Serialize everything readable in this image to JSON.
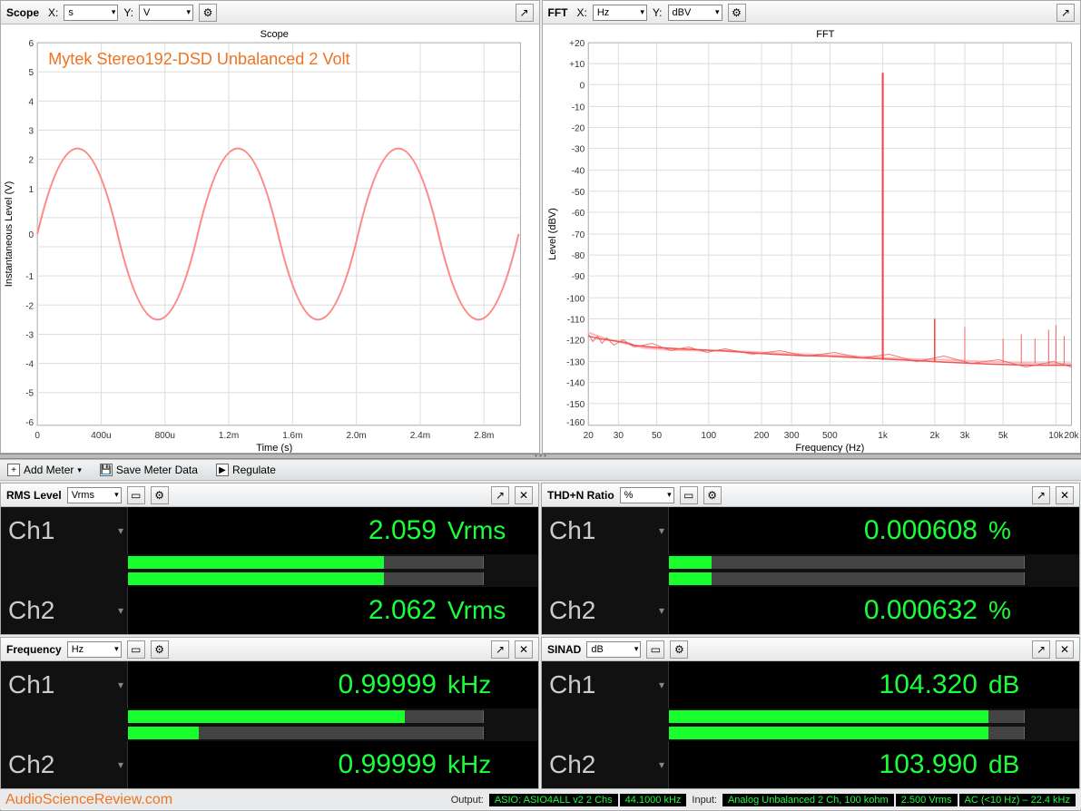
{
  "scope": {
    "title": "Scope",
    "xLabel": "X:",
    "xUnit": "s",
    "yLabel": "Y:",
    "yUnit": "V",
    "graphTitle": "Scope",
    "xAxis": "Time (s)",
    "yAxis": "Instantaneous Level (V)",
    "annotation": "Mytek Stereo192-DSD Unbalanced 2 Volt",
    "yticks": [
      "6",
      "5",
      "4",
      "3",
      "2",
      "1",
      "0",
      "-1",
      "-2",
      "-3",
      "-4",
      "-5",
      "-6"
    ],
    "xticks": [
      "0",
      "400u",
      "800u",
      "1.2m",
      "1.6m",
      "2.0m",
      "2.4m",
      "2.8m"
    ]
  },
  "fft": {
    "title": "FFT",
    "xLabel": "X:",
    "xUnit": "Hz",
    "yLabel": "Y:",
    "yUnit": "dBV",
    "graphTitle": "FFT",
    "xAxis": "Frequency (Hz)",
    "yAxis": "Level (dBV)",
    "yticks": [
      "+20",
      "+10",
      "0",
      "-10",
      "-20",
      "-30",
      "-40",
      "-50",
      "-60",
      "-70",
      "-80",
      "-90",
      "-100",
      "-110",
      "-120",
      "-130",
      "-140",
      "-150",
      "-160"
    ],
    "xticks": [
      "20",
      "30",
      "50",
      "100",
      "200",
      "300",
      "500",
      "1k",
      "2k",
      "3k",
      "5k",
      "10k",
      "20k"
    ]
  },
  "toolbar": {
    "addMeter": "Add Meter",
    "saveMeter": "Save Meter Data",
    "regulate": "Regulate"
  },
  "meters": {
    "rms": {
      "title": "RMS Level",
      "unit": "Vrms",
      "ch1": {
        "label": "Ch1",
        "value": "2.059",
        "unit": "Vrms",
        "barPct": 72
      },
      "ch2": {
        "label": "Ch2",
        "value": "2.062",
        "unit": "Vrms",
        "barPct": 72
      }
    },
    "thdn": {
      "title": "THD+N Ratio",
      "unit": "%",
      "ch1": {
        "label": "Ch1",
        "value": "0.000608",
        "unit": "%",
        "barPct": 12
      },
      "ch2": {
        "label": "Ch2",
        "value": "0.000632",
        "unit": "%",
        "barPct": 12
      }
    },
    "freq": {
      "title": "Frequency",
      "unit": "Hz",
      "ch1": {
        "label": "Ch1",
        "value": "0.99999",
        "unit": "kHz",
        "barPct": 78
      },
      "ch2": {
        "label": "Ch2",
        "value": "0.99999",
        "unit": "kHz",
        "barPct": 20
      }
    },
    "sinad": {
      "title": "SINAD",
      "unit": "dB",
      "ch1": {
        "label": "Ch1",
        "value": "104.320",
        "unit": "dB",
        "barPct": 90
      },
      "ch2": {
        "label": "Ch2",
        "value": "103.990",
        "unit": "dB",
        "barPct": 90
      }
    }
  },
  "footer": {
    "brand": "AudioScienceReview.com",
    "outputLabel": "Output:",
    "output1": "ASIO: ASIO4ALL v2 2 Chs",
    "output2": "44.1000 kHz",
    "inputLabel": "Input:",
    "input1": "Analog Unbalanced 2 Ch, 100 kohm",
    "input2": "2.500 Vrms",
    "input3": "AC (<10 Hz) – 22.4 kHz"
  },
  "chart_data": [
    {
      "type": "line",
      "title": "Scope",
      "xlabel": "Time (s)",
      "ylabel": "Instantaneous Level (V)",
      "xlim": [
        0,
        0.003
      ],
      "ylim": [
        -6.5,
        6.5
      ],
      "series": [
        {
          "name": "sine ~1 kHz",
          "amplitude": 2.9,
          "frequency_hz": 1000,
          "dc_offset": 0
        }
      ],
      "note": "roughly 2.9 V-peak 1 kHz sine, ~3 cycles shown"
    },
    {
      "type": "line",
      "title": "FFT",
      "xlabel": "Frequency (Hz)",
      "ylabel": "Level (dBV)",
      "xscale": "log",
      "xlim": [
        20,
        20000
      ],
      "ylim": [
        -160,
        20
      ],
      "fundamental": {
        "freq_hz": 1000,
        "level_dbv": 6
      },
      "noise_floor_dbv": -135,
      "harmonics_approx": [
        {
          "freq_hz": 2000,
          "level_dbv": -115
        },
        {
          "freq_hz": 3000,
          "level_dbv": -120
        },
        {
          "freq_hz": 5000,
          "level_dbv": -125
        },
        {
          "freq_hz": 10000,
          "level_dbv": -118
        }
      ]
    }
  ]
}
